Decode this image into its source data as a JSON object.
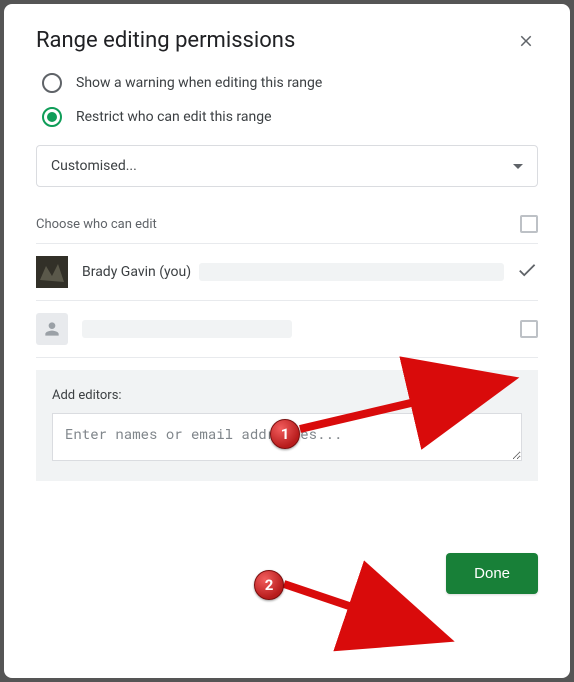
{
  "dialog": {
    "title": "Range editing permissions",
    "options": {
      "warning": "Show a warning when editing this range",
      "restrict": "Restrict who can edit this range"
    },
    "dropdown": {
      "selected": "Customised..."
    },
    "choose_label": "Choose who can edit",
    "users": [
      {
        "name": "Brady Gavin (you)"
      }
    ],
    "editors": {
      "label": "Add editors:",
      "placeholder": "Enter names or email addresses..."
    },
    "done_label": "Done"
  },
  "annotations": {
    "badge1": "1",
    "badge2": "2"
  }
}
